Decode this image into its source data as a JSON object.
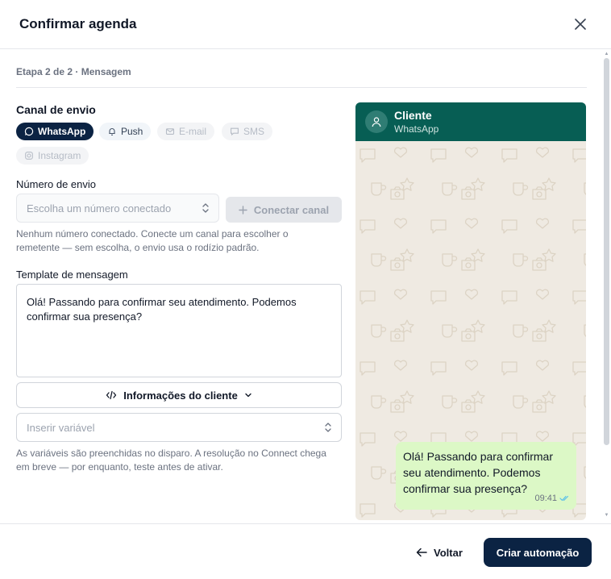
{
  "dialog": {
    "title": "Confirmar agenda"
  },
  "step": {
    "text": "Etapa 2 de 2 · Mensagem"
  },
  "channel": {
    "label": "Canal de envio",
    "options": [
      {
        "label": "WhatsApp",
        "icon": "whatsapp-icon",
        "state": "selected"
      },
      {
        "label": "Push",
        "icon": "bell-icon",
        "state": "available"
      },
      {
        "label": "E-mail",
        "icon": "mail-icon",
        "state": "disabled"
      },
      {
        "label": "SMS",
        "icon": "message-icon",
        "state": "disabled"
      },
      {
        "label": "Instagram",
        "icon": "instagram-icon",
        "state": "disabled"
      }
    ]
  },
  "sender": {
    "label": "Número de envio",
    "placeholder": "Escolha um número conectado",
    "connect_label": "Conectar canal",
    "help": "Nenhum número conectado. Conecte um canal para escolher o remetente — sem escolha, o envio usa o rodízio padrão."
  },
  "template": {
    "label": "Template de mensagem",
    "value": "Olá! Passando para confirmar seu atendimento. Podemos confirmar sua presença?",
    "info_button": "Informações do cliente",
    "variable_placeholder": "Inserir variável",
    "help": "As variáveis são preenchidas no disparo. A resolução no Connect chega em breve — por enquanto, teste antes de ativar."
  },
  "preview": {
    "contact_name": "Cliente",
    "contact_sub": "WhatsApp",
    "message": "Olá! Passando para confirmar seu atendimento. Podemos confirmar sua presença?",
    "time": "09:41"
  },
  "footer": {
    "back_label": "Voltar",
    "submit_label": "Criar automação"
  },
  "colors": {
    "primary": "#0b2343",
    "whatsapp_header": "#075e54",
    "bubble": "#dcf8c6",
    "chat_bg": "#efeae2"
  }
}
